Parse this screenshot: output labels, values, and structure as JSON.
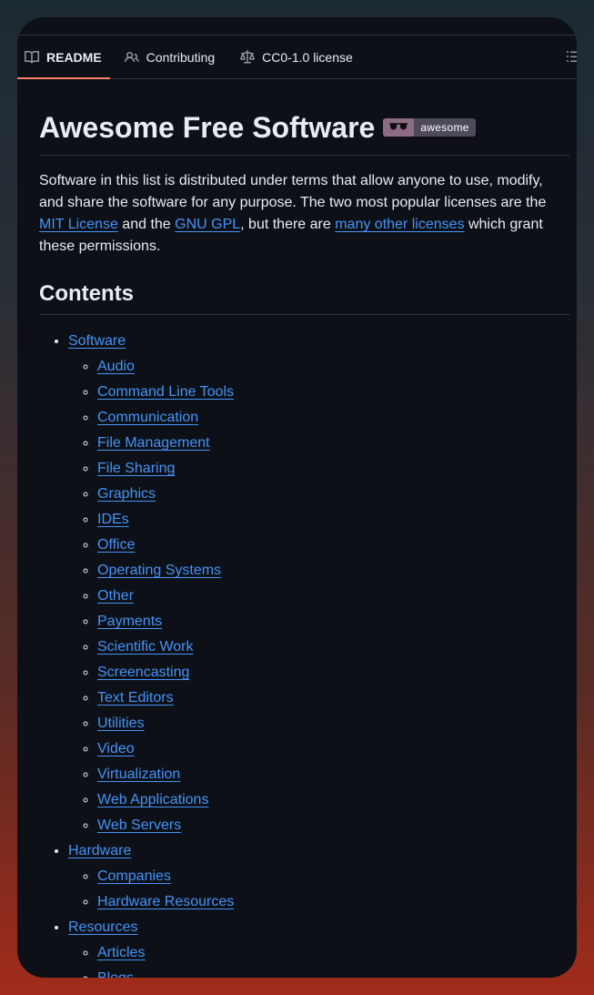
{
  "tabs": [
    {
      "label": "README",
      "icon": "book-icon",
      "active": true
    },
    {
      "label": "Contributing",
      "icon": "people-icon",
      "active": false
    },
    {
      "label": "CC0-1.0 license",
      "icon": "law-icon",
      "active": false
    }
  ],
  "readme": {
    "title": "Awesome Free Software",
    "badge_label": "awesome",
    "intro": {
      "part1": "Software in this list is distributed under terms that allow anyone to use, modify, and share the software for any purpose. The two most popular licenses are the ",
      "link1": "MIT License",
      "part2": " and the ",
      "link2": "GNU GPL",
      "part3": ", but there are ",
      "link3": "many other licenses",
      "part4": " which grant these permissions."
    },
    "contents_heading": "Contents",
    "toc": [
      {
        "label": "Software",
        "children": [
          "Audio",
          "Command Line Tools",
          "Communication",
          "File Management",
          "File Sharing",
          "Graphics",
          "IDEs",
          "Office",
          "Operating Systems",
          "Other",
          "Payments",
          "Scientific Work",
          "Screencasting",
          "Text Editors",
          "Utilities",
          "Video",
          "Virtualization",
          "Web Applications",
          "Web Servers"
        ]
      },
      {
        "label": "Hardware",
        "children": [
          "Companies",
          "Hardware Resources"
        ]
      },
      {
        "label": "Resources",
        "children": [
          "Articles",
          "Blogs"
        ]
      }
    ]
  },
  "colors": {
    "link": "#4493f8",
    "active_tab_underline": "#f78166",
    "background": "#0d1117"
  }
}
